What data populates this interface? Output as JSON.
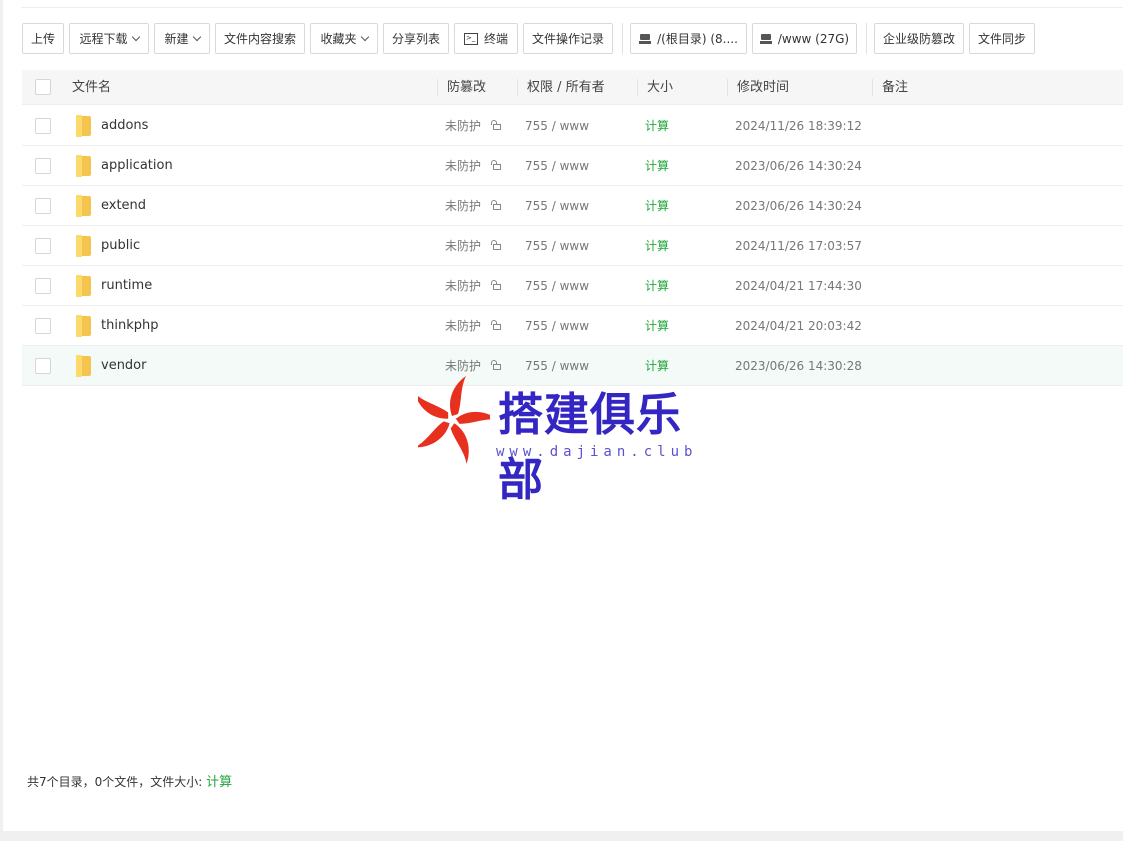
{
  "toolbar": {
    "upload": "上传",
    "remote_download": "远程下载",
    "new": "新建",
    "content_search": "文件内容搜索",
    "favorites": "收藏夹",
    "share_list": "分享列表",
    "terminal": "终端",
    "op_log": "文件操作记录",
    "disk_root": "/(根目录) (8....",
    "disk_www": "/www (27G)",
    "enterprise_tamper": "企业级防篡改",
    "file_sync": "文件同步"
  },
  "table": {
    "headers": {
      "name": "文件名",
      "tamper": "防篡改",
      "perm": "权限 / 所有者",
      "size": "大小",
      "mtime": "修改时间",
      "note": "备注"
    },
    "rows": [
      {
        "name": "addons",
        "tamper": "未防护",
        "perm": "755 / www",
        "size": "计算",
        "mtime": "2024/11/26 18:39:12"
      },
      {
        "name": "application",
        "tamper": "未防护",
        "perm": "755 / www",
        "size": "计算",
        "mtime": "2023/06/26 14:30:24"
      },
      {
        "name": "extend",
        "tamper": "未防护",
        "perm": "755 / www",
        "size": "计算",
        "mtime": "2023/06/26 14:30:24"
      },
      {
        "name": "public",
        "tamper": "未防护",
        "perm": "755 / www",
        "size": "计算",
        "mtime": "2024/11/26 17:03:57"
      },
      {
        "name": "runtime",
        "tamper": "未防护",
        "perm": "755 / www",
        "size": "计算",
        "mtime": "2024/04/21 17:44:30"
      },
      {
        "name": "thinkphp",
        "tamper": "未防护",
        "perm": "755 / www",
        "size": "计算",
        "mtime": "2024/04/21 20:03:42"
      },
      {
        "name": "vendor",
        "tamper": "未防护",
        "perm": "755 / www",
        "size": "计算",
        "mtime": "2023/06/26 14:30:28"
      }
    ]
  },
  "watermark": {
    "title": "搭建俱乐部",
    "url": "www.dajian.club",
    "colors": {
      "logo": "#e8301e",
      "text": "#3426c2"
    }
  },
  "footer": {
    "summary": "共7个目录，0个文件，文件大小:",
    "calc": "计算"
  },
  "colors": {
    "accent_green": "#20a53a",
    "selected_row": "#f3faf8"
  }
}
